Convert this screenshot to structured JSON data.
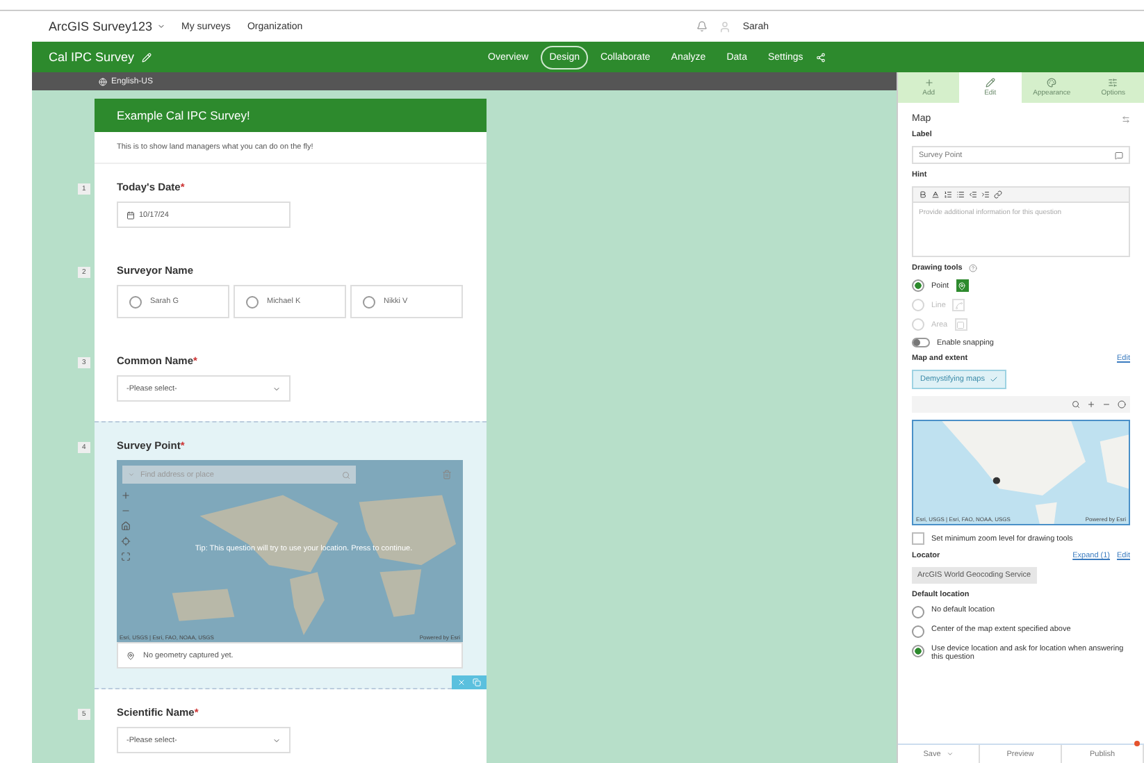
{
  "topbar": {
    "app_title": "ArcGIS Survey123",
    "links": [
      "My surveys",
      "Organization"
    ],
    "user": "Sarah"
  },
  "survey_bar": {
    "title": "Cal IPC Survey",
    "nav": [
      {
        "label": "Overview",
        "selected": false
      },
      {
        "label": "Design",
        "selected": true
      },
      {
        "label": "Collaborate",
        "selected": false
      },
      {
        "label": "Analyze",
        "selected": false
      },
      {
        "label": "Data",
        "selected": false
      },
      {
        "label": "Settings",
        "selected": false
      }
    ]
  },
  "language": "English-US",
  "form": {
    "header": "Example Cal IPC Survey!",
    "description": "This is to show land managers what you can do on the fly!",
    "questions": [
      {
        "number": "1",
        "kind": "date",
        "label": "Today's Date",
        "required_mark": "*",
        "value": "10/17/24",
        "selected": false
      },
      {
        "number": "2",
        "kind": "radio",
        "label": "Surveyor Name",
        "options": [
          "Sarah G",
          "Michael K",
          "Nikki V"
        ],
        "selected": false
      },
      {
        "number": "3",
        "kind": "select",
        "label": "Common Name",
        "required_mark": "*",
        "placeholder": "-Please select-",
        "selected": false
      },
      {
        "number": "4",
        "kind": "map",
        "label": "Survey Point",
        "required_mark": "*",
        "search_placeholder": "Find address or place",
        "tip": "Tip: This question will try to use your location. Press to continue.",
        "attribution": "Esri, USGS | Esri, FAO, NOAA, USGS",
        "powered": "Powered by Esri",
        "status": "No geometry captured yet.",
        "selected": true
      },
      {
        "number": "5",
        "kind": "select",
        "label": "Scientific Name",
        "required_mark": "*",
        "placeholder": "-Please select-",
        "selected": false
      }
    ]
  },
  "panel": {
    "tabs": [
      {
        "label": "Add",
        "selected": false
      },
      {
        "label": "Edit",
        "selected": true
      },
      {
        "label": "Appearance",
        "selected": false
      },
      {
        "label": "Options",
        "selected": false
      }
    ],
    "section_title": "Map",
    "label_field": {
      "label": "Label",
      "value": "Survey Point"
    },
    "hint": {
      "label": "Hint",
      "placeholder": "Provide additional information for this question"
    },
    "drawing_tools": {
      "label": "Drawing tools",
      "options": [
        {
          "label": "Point",
          "selected": true,
          "disabled": false
        },
        {
          "label": "Line",
          "selected": false,
          "disabled": true
        },
        {
          "label": "Area",
          "selected": false,
          "disabled": true
        }
      ]
    },
    "snapping": {
      "label": "Enable snapping",
      "on": false
    },
    "map_extent": {
      "label": "Map and extent",
      "edit": "Edit",
      "chip": "Demystifying maps",
      "attribution": "Esri, USGS | Esri, FAO, NOAA, USGS",
      "powered": "Powered by Esri"
    },
    "min_zoom": {
      "label": "Set minimum zoom level for drawing tools",
      "checked": false
    },
    "locator": {
      "label": "Locator",
      "expand": "Expand (1)",
      "edit": "Edit",
      "value": "ArcGIS World Geocoding Service"
    },
    "default_location": {
      "label": "Default location",
      "options": [
        {
          "label": "No default location",
          "selected": false
        },
        {
          "label": "Center of the map extent specified above",
          "selected": false
        },
        {
          "label": "Use device location and ask for location when answering this question",
          "selected": true
        }
      ]
    },
    "footer": [
      "Save",
      "Preview",
      "Publish"
    ]
  }
}
